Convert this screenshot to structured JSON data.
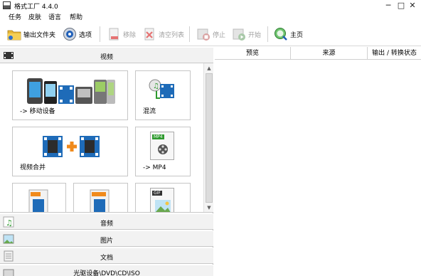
{
  "window": {
    "title": "格式工厂 4.4.0",
    "controls": [
      "─",
      "□",
      "✕"
    ]
  },
  "menu": [
    "任务",
    "皮肤",
    "语言",
    "帮助"
  ],
  "toolbar": {
    "output_folder": "输出文件夹",
    "options": "选项",
    "remove": "移除",
    "clear_list": "清空列表",
    "stop": "停止",
    "start": "开始",
    "home": "主页"
  },
  "categories": {
    "video": "视频",
    "audio": "音频",
    "image": "图片",
    "document": "文档",
    "optical": "光驱设备\\DVD\\CD\\ISO"
  },
  "tiles": {
    "mobile": "-> 移动设备",
    "mix": "混流",
    "merge": "视频合并",
    "mp4": "-> MP4",
    "mp4_badge": "MP4",
    "gif_badge": "GIF"
  },
  "columns": [
    "预览",
    "来源",
    "输出 / 转换状态"
  ],
  "colors": {
    "accent_green": "#2e9a2e",
    "film_blue": "#1e6bb8",
    "orange": "#f08a1c"
  }
}
